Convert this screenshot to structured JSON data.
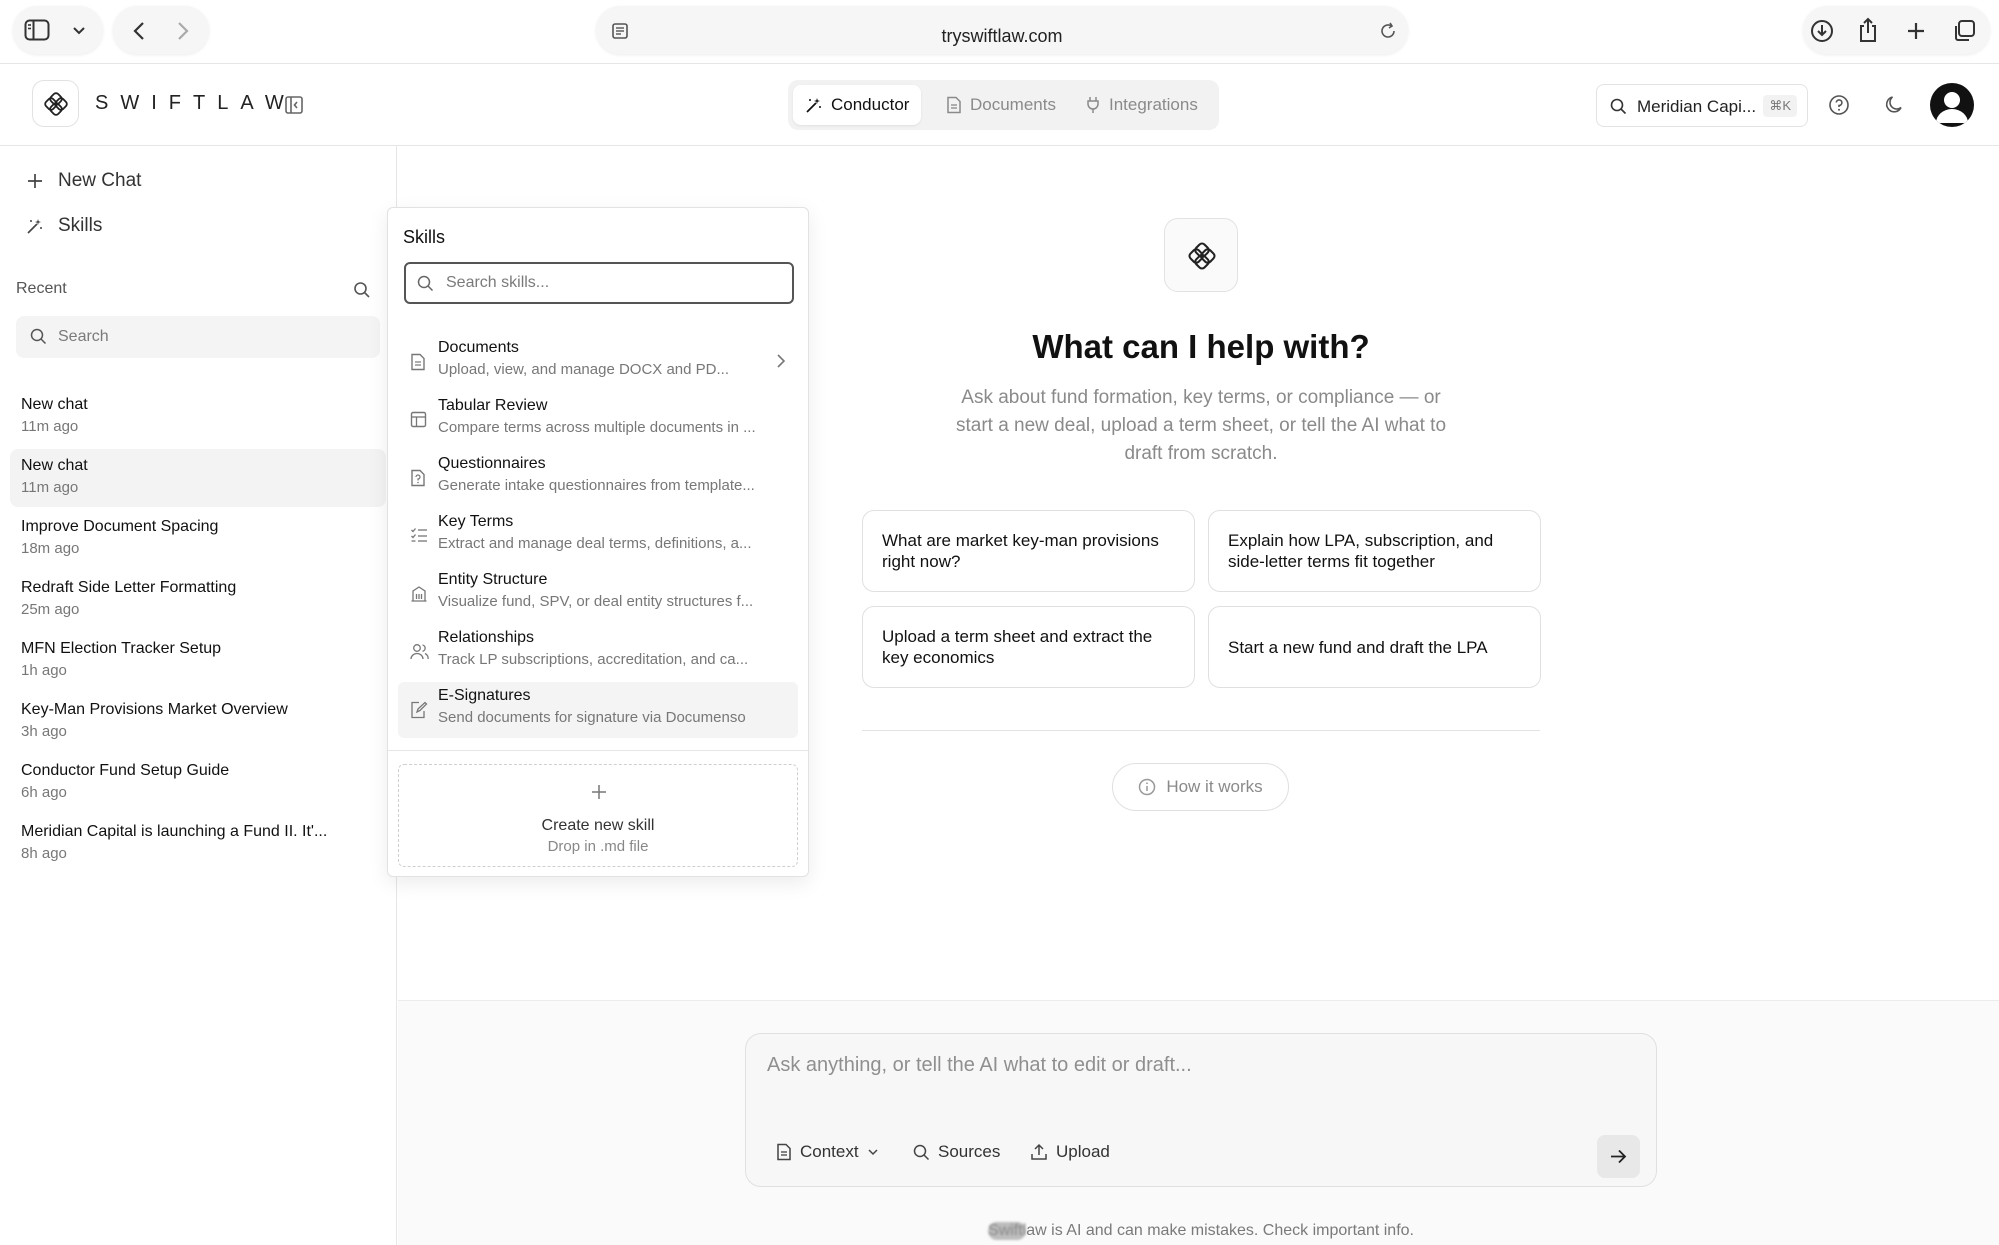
{
  "browser": {
    "url": "tryswiftlaw.com"
  },
  "header": {
    "brand": "SWIFTLAW",
    "tabs": [
      {
        "label": "Conductor",
        "icon": "wand-icon",
        "active": true
      },
      {
        "label": "Documents",
        "icon": "document-icon",
        "active": false
      },
      {
        "label": "Integrations",
        "icon": "plug-icon",
        "active": false
      }
    ],
    "search_value": "Meridian Capi...",
    "search_shortcut": "⌘K"
  },
  "sidebar": {
    "new_chat_label": "New Chat",
    "skills_label": "Skills",
    "recent_label": "Recent",
    "search_placeholder": "Search",
    "chats": [
      {
        "title": "New chat",
        "time": "11m ago",
        "selected": false
      },
      {
        "title": "New chat",
        "time": "11m ago",
        "selected": true
      },
      {
        "title": "Improve Document Spacing",
        "time": "18m ago",
        "selected": false
      },
      {
        "title": "Redraft Side Letter Formatting",
        "time": "25m ago",
        "selected": false
      },
      {
        "title": "MFN Election Tracker Setup",
        "time": "1h ago",
        "selected": false
      },
      {
        "title": "Key-Man Provisions Market Overview",
        "time": "3h ago",
        "selected": false
      },
      {
        "title": "Conductor Fund Setup Guide",
        "time": "6h ago",
        "selected": false
      },
      {
        "title": "Meridian Capital is launching a Fund II. It'...",
        "time": "8h ago",
        "selected": false
      }
    ]
  },
  "skills": {
    "title": "Skills",
    "search_placeholder": "Search skills...",
    "items": [
      {
        "name": "Documents",
        "desc": "Upload, view, and manage DOCX and PD...",
        "icon": "document-icon",
        "has_submenu": true
      },
      {
        "name": "Tabular Review",
        "desc": "Compare terms across multiple documents in ...",
        "icon": "table-icon",
        "has_submenu": false
      },
      {
        "name": "Questionnaires",
        "desc": "Generate intake questionnaires from template...",
        "icon": "questionnaire-icon",
        "has_submenu": false
      },
      {
        "name": "Key Terms",
        "desc": "Extract and manage deal terms, definitions, a...",
        "icon": "checklist-icon",
        "has_submenu": false
      },
      {
        "name": "Entity Structure",
        "desc": "Visualize fund, SPV, or deal entity structures f...",
        "icon": "building-icon",
        "has_submenu": false
      },
      {
        "name": "Relationships",
        "desc": "Track LP subscriptions, accreditation, and ca...",
        "icon": "users-icon",
        "has_submenu": false
      },
      {
        "name": "E-Signatures",
        "desc": "Send documents for signature via Documenso",
        "icon": "signature-icon",
        "has_submenu": false
      }
    ],
    "create_title": "Create new skill",
    "create_sub": "Drop in .md file"
  },
  "main": {
    "title": "What can I help with?",
    "subtitle": "Ask about fund formation, key terms, or compliance — or start a new deal, upload a term sheet, or tell the AI what to draft from scratch.",
    "suggestions": [
      "What are market key-man provisions right now?",
      "Explain how LPA, subscription, and side-letter terms fit together",
      "Upload a term sheet and extract the key economics",
      "Start a new fund and draft the LPA"
    ],
    "how_it_works": "How it works",
    "composer_placeholder": "Ask anything, or tell the AI what to edit or draft...",
    "composer_buttons": {
      "context": "Context",
      "sources": "Sources",
      "upload": "Upload"
    },
    "disclaimer_blurred": "Swiftl",
    "disclaimer_rest": "aw is AI and can make mistakes. Check important info."
  }
}
